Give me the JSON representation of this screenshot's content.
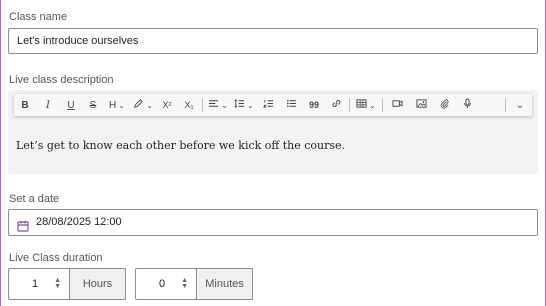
{
  "class_name": {
    "label": "Class name",
    "value": "Let's introduce ourselves"
  },
  "description": {
    "label": "Live class description",
    "body": "Let’s get to know each other before we kick off the course.",
    "toolbar": {
      "bold": "B",
      "italic": "I",
      "underline": "U",
      "strike": "S",
      "heading": "H",
      "superscript": "X²",
      "subscript": "X₁",
      "quote": "99"
    }
  },
  "date": {
    "label": "Set a date",
    "value": "28/08/2025 12:00"
  },
  "duration": {
    "label": "Live Class duration",
    "hours_value": "1",
    "hours_unit": "Hours",
    "minutes_value": "0",
    "minutes_unit": "Minutes"
  },
  "colors": {
    "frame": "#9b6fc4",
    "calendar_icon": "#7b4fa6"
  }
}
